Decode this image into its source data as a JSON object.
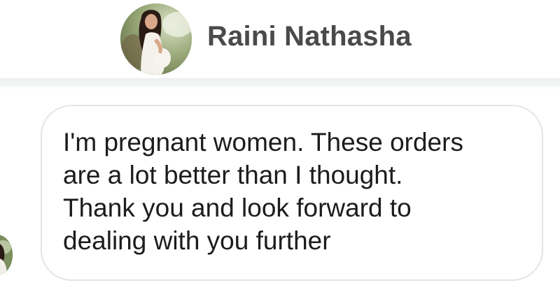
{
  "header": {
    "contact_name": "Raini Nathasha",
    "avatar_icon": "profile-photo-pregnant-woman"
  },
  "thread": {
    "sender_avatar_icon": "profile-photo-thumbnail",
    "message": {
      "lines": [
        "I'm pregnant women. These orders",
        "are a lot better than I thought.",
        "Thank you and look forward to",
        "dealing with you further"
      ]
    }
  },
  "colors": {
    "name_text": "#4a4a4a",
    "message_text": "#1c1c1c",
    "bubble_border": "#e3e5e8",
    "divider": "#eceef0"
  }
}
